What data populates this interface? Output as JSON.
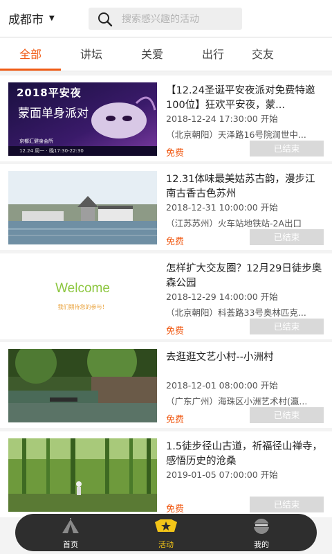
{
  "header": {
    "city": "成都市",
    "search_placeholder": "搜索感兴趣的活动"
  },
  "tabs": [
    {
      "label": "全部",
      "active": true
    },
    {
      "label": "讲坛",
      "active": false
    },
    {
      "label": "关爱",
      "active": false
    },
    {
      "label": "出行",
      "active": false
    },
    {
      "label": "交友",
      "active": false
    }
  ],
  "events": [
    {
      "title": "【12.24圣诞平安夜派对免费特邀100位】狂欢平安夜，蒙...",
      "time": "2018-12-24 17:30:00 开始",
      "location": "（北京朝阳）天泽路16号院润世中...",
      "price": "免费",
      "status": "已结束",
      "poster": {
        "heading": "2018平安夜",
        "sub": "蒙面单身派对",
        "org": "京都汇健身会所",
        "date": "12.24 周一 · 晚17:30-22:30"
      }
    },
    {
      "title": "12.31体味最美姑苏古韵，漫步江南古香古色苏州",
      "time": "2018-12-31 10:00:00 开始",
      "location": "（江苏苏州）火车站地铁站-2A出口",
      "price": "免费",
      "status": "已结束"
    },
    {
      "title": "怎样扩大交友圈？12月29日徒步奥森公园",
      "time": "2018-12-29 14:00:00 开始",
      "location": "（北京朝阳）科荟路33号奥林匹克...",
      "price": "免费",
      "status": "已结束",
      "poster": {
        "welcome": "Welcome",
        "tagline": "我们期待您的参与！"
      }
    },
    {
      "title": "去逛逛文艺小村--小洲村",
      "time": "2018-12-01 08:00:00 开始",
      "location": "（广东广州）海珠区小洲艺术村(瀛...",
      "price": "免费",
      "status": "已结束"
    },
    {
      "title": "1.5徒步径山古道，祈福径山禅寺，感悟历史的沧桑",
      "time": "2019-01-05 07:00:00 开始",
      "location": "",
      "price": "免费",
      "status": "已结束"
    }
  ],
  "bottom_nav": [
    {
      "label": "首页",
      "icon": "tent-icon",
      "active": false
    },
    {
      "label": "活动",
      "icon": "star-badge-icon",
      "active": true
    },
    {
      "label": "我的",
      "icon": "helmet-icon",
      "active": false
    }
  ],
  "colors": {
    "accent": "#f05a14",
    "nav_active": "#f3c518",
    "nav_bg": "#2e2e2e",
    "status_bg": "#d9d9d9"
  }
}
